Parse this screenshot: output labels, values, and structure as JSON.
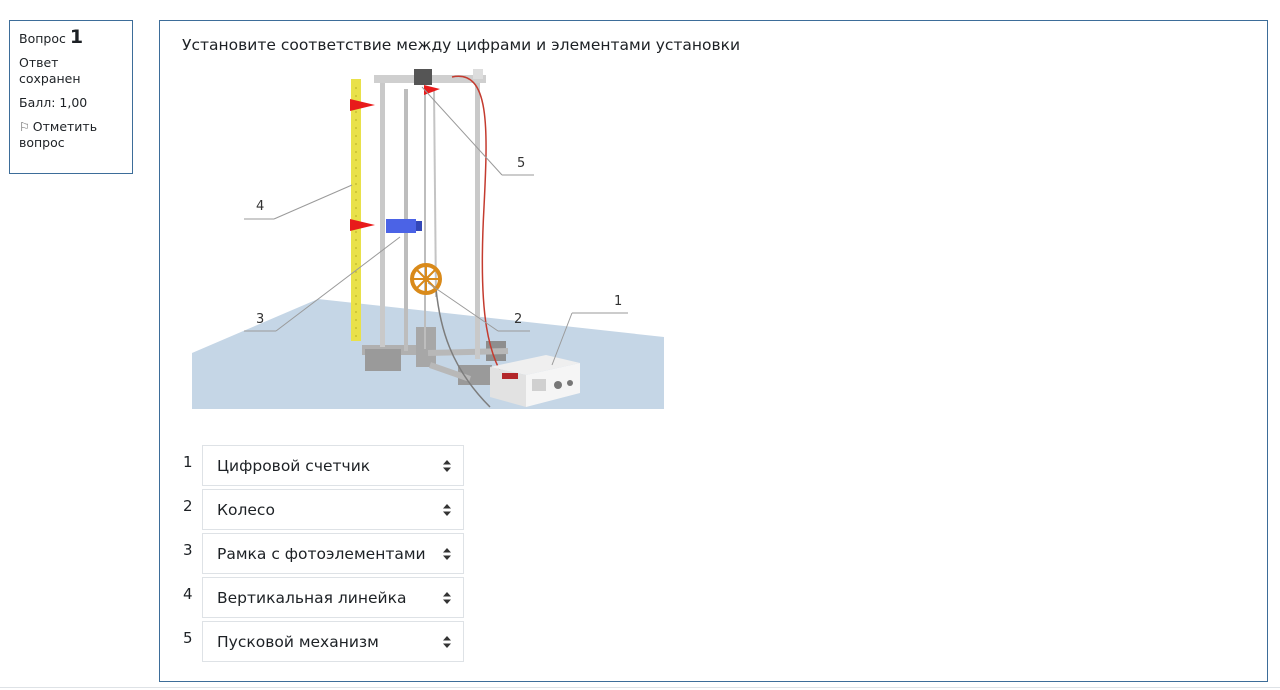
{
  "info": {
    "question_label": "Вопрос",
    "question_number": "1",
    "state": "Ответ сохранен",
    "grade": "Балл: 1,00",
    "flag_label": "Отметить вопрос"
  },
  "question": {
    "text": "Установите соответствие между цифрами и элементами установки",
    "figure_labels": [
      "1",
      "2",
      "3",
      "4",
      "5"
    ],
    "rows": [
      {
        "number": "1",
        "selected": "Цифровой счетчик"
      },
      {
        "number": "2",
        "selected": "Колесо"
      },
      {
        "number": "3",
        "selected": "Рамка с фотоэлементами"
      },
      {
        "number": "4",
        "selected": "Вертикальная линейка"
      },
      {
        "number": "5",
        "selected": "Пусковой механизм"
      }
    ]
  },
  "colors": {
    "border": "#3d6d99",
    "select_border": "#dee2e6",
    "text": "#1d2125"
  }
}
